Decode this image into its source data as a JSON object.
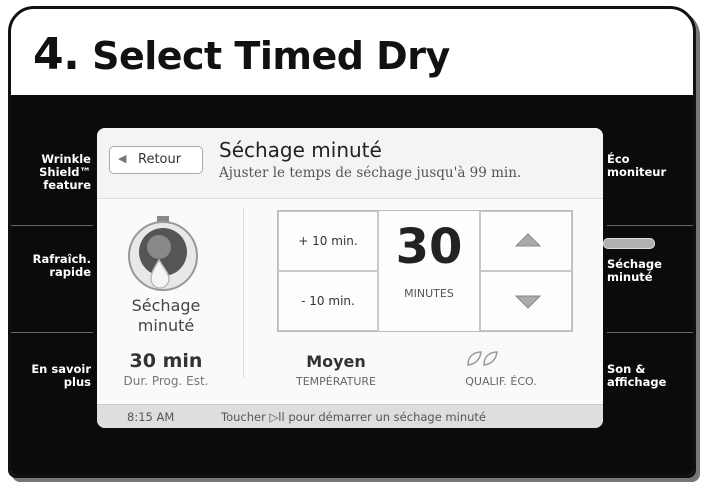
{
  "heading": {
    "number": "4.",
    "text": "Select Timed Dry"
  },
  "left_menu": [
    {
      "label": "Wrinkle Shield™ feature"
    },
    {
      "label": "Rafraîch. rapide"
    },
    {
      "label": "En savoir plus"
    }
  ],
  "right_menu": [
    {
      "label": "Éco moniteur"
    },
    {
      "label": "Séchage minuté",
      "active": true
    },
    {
      "label": "Son & affichage"
    }
  ],
  "screen": {
    "back_label": "Retour",
    "title": "Séchage minuté",
    "subtitle": "Ajuster le temps de séchage jusqu'à 99 min.",
    "cycle_icon": "water-drop-dial-icon",
    "cycle_name_line1": "Séchage",
    "cycle_name_line2": "minuté",
    "plus_label": "+ 10 min.",
    "minus_label": "- 10 min.",
    "minutes_value": "30",
    "minutes_unit": "MINUTES",
    "est_time_value": "30 min",
    "est_time_label": "Dur. Prog. Est.",
    "temperature_value": "Moyen",
    "temperature_label": "TEMPÉRATURE",
    "eco_label": "QUALIF. ÉCO.",
    "eco_leaves": 2,
    "status_time": "8:15 AM",
    "status_text": "Toucher ▷ll pour démarrer un séchage minuté"
  },
  "colors": {
    "panel": "#0b0b0b",
    "screen": "#fafafa",
    "active_pill": "#b0b0b0"
  }
}
